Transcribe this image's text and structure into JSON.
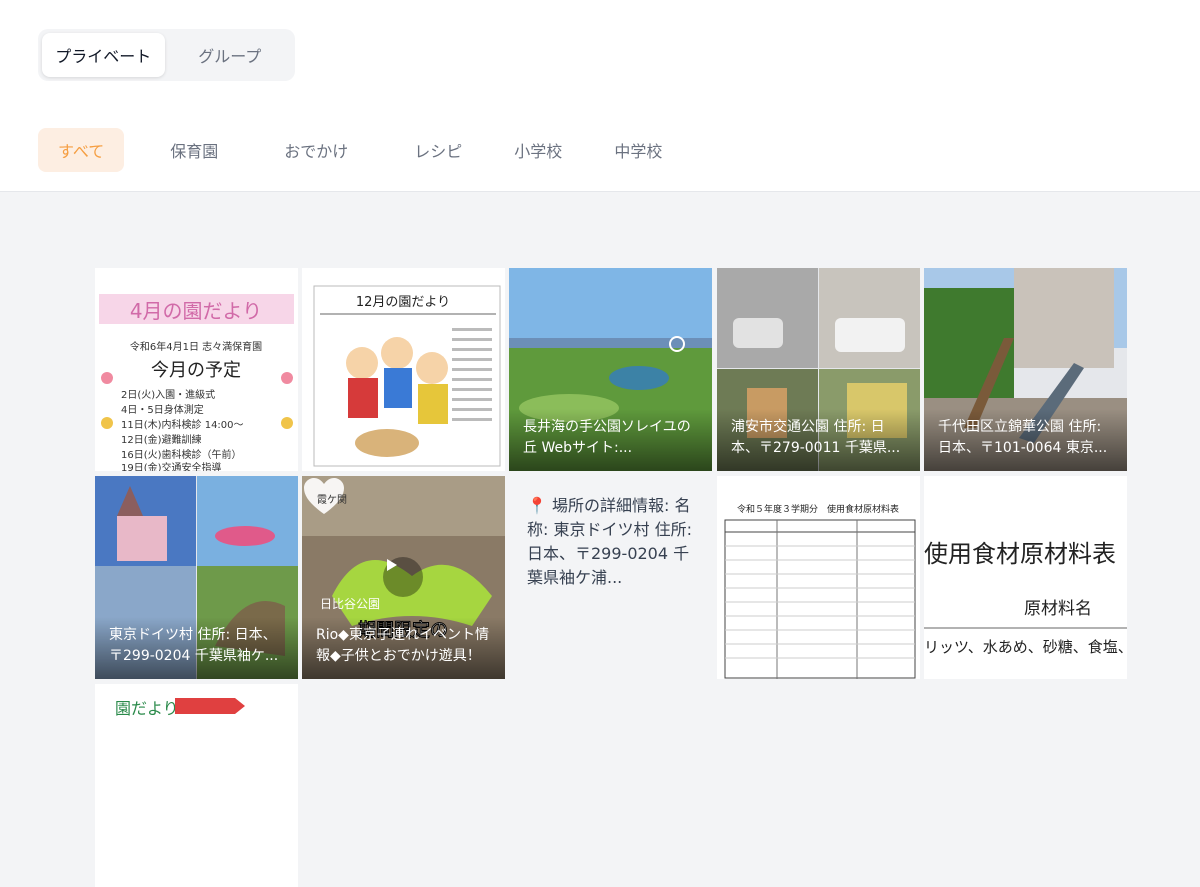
{
  "header": {
    "segments": [
      {
        "label": "プライベート",
        "active": true
      },
      {
        "label": "グループ",
        "active": false
      }
    ],
    "categories": [
      {
        "label": "すべて",
        "active": true
      },
      {
        "label": "保育園"
      },
      {
        "label": "おでかけ"
      },
      {
        "label": "レシピ"
      },
      {
        "label": "小学校"
      },
      {
        "label": "中学校"
      }
    ]
  },
  "tiles": [
    {
      "kind": "image",
      "caption": "",
      "image_text": "4月の園だより / 令和6年4月1日 志々満保育園 / 今月の予定 / 2日(火)入園・進級式 / 4日・5日身体測定 / 11日(木)内科検診 14:00〜 / 12日(金)避難訓練 / 16日(火)歯科検診（午前） / 19日(金)交通安全指導"
    },
    {
      "kind": "image",
      "caption": "",
      "image_text": "12月の園だより"
    },
    {
      "kind": "image",
      "caption": "長井海の手公園ソレイユの丘 Webサイト:..."
    },
    {
      "kind": "image",
      "caption": "浦安市交通公園 住所: 日本、〒279-0011 千葉県..."
    },
    {
      "kind": "image",
      "caption": "千代田区立錦華公園 住所: 日本、〒101-0064 東京..."
    },
    {
      "kind": "image",
      "caption": "東京ドイツ村 住所: 日本、〒299-0204 千葉県袖ケ..."
    },
    {
      "kind": "video",
      "caption": "Rio◆東京子連れイベント情報◆子供とおでかけ遊具！",
      "badge": "霞ケ関",
      "image_text": "日比谷公園 期間限定の"
    },
    {
      "kind": "text",
      "text": "📍 場所の詳細情報: 名称: 東京ドイツ村 住所: 日本、〒299-0204 千葉県袖ケ浦..."
    },
    {
      "kind": "image",
      "caption": "",
      "image_text": "令和５年度３学期分　使用食材原材料表"
    },
    {
      "kind": "image",
      "caption": "",
      "image_text": "使用食材原材料表 / 原材料名 / リッツ、水あめ、砂糖、食塩、"
    },
    {
      "kind": "image",
      "caption": "",
      "image_text": "園だより"
    }
  ],
  "colors": {
    "accent": "#f59e42",
    "accent_bg": "#fdeee2"
  }
}
